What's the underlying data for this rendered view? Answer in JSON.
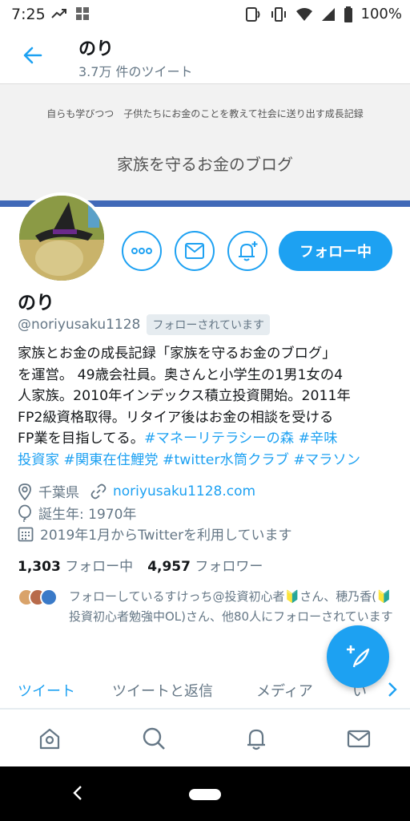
{
  "status_bar": {
    "time": "7:25",
    "battery": "100%"
  },
  "header": {
    "title": "のり",
    "subtitle": "3.7万 件のツイート"
  },
  "banner": {
    "tagline": "自らも学びつつ　子供たちにお金のことを教えて社会に送り出す成長記録",
    "blog_title": "家族を守るお金のブログ"
  },
  "profile": {
    "name": "のり",
    "handle": "@noriyusaku1128",
    "follows_you": "フォローされています",
    "follow_button": "フォロー中",
    "bio_lines": [
      "家族とお金の成長記録「家族を守るお金のブログ」",
      "を運営。 49歳会社員。奥さんと小学生の1男1女の4",
      "人家族。2010年インデックス積立投資開始。2011年",
      "FP2級資格取得。リタイア後はお金の相談を受ける"
    ],
    "bio_line5_text": "FP業を目指してる。",
    "bio_tags_line5": [
      "#マネーリテラシーの森",
      "#辛味"
    ],
    "bio_tags_line6": [
      "投資家",
      "#関東在住鯉党",
      "#twitter水筒クラブ",
      "#マラソン"
    ],
    "location": "千葉県",
    "website": "noriyusaku1128.com",
    "birth": "誕生年: 1970年",
    "joined": "2019年1月からTwitterを利用しています",
    "following_count": "1,303",
    "following_label": "フォロー中",
    "followers_count": "4,957",
    "followers_label": "フォロワー",
    "followed_by": "フォローしているすけっち@投資初心者🔰さん、穂乃香(🔰投資初心者勉強中OL)さん、他80人にフォローされています"
  },
  "tabs": [
    "ツイート",
    "ツイートと返信",
    "メディア",
    "い"
  ],
  "colors": {
    "accent": "#1da1f2",
    "muted": "#657786",
    "banner_stripe": "#4169b8"
  },
  "icons": [
    "back-arrow-icon",
    "more-icon",
    "message-icon",
    "notify-add-icon",
    "location-icon",
    "link-icon",
    "birthday-icon",
    "calendar-icon",
    "compose-icon",
    "home-icon",
    "search-icon",
    "notifications-icon",
    "messages-icon"
  ]
}
